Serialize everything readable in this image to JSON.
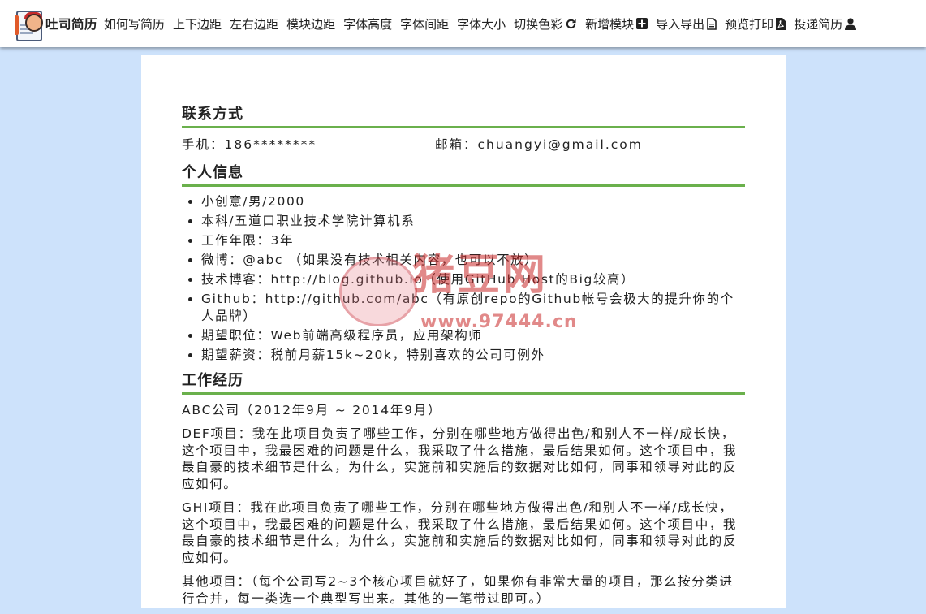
{
  "header": {
    "brand": "吐司简历",
    "nav": [
      {
        "label": "如何写简历",
        "icon": ""
      },
      {
        "label": "上下边距",
        "icon": ""
      },
      {
        "label": "左右边距",
        "icon": ""
      },
      {
        "label": "模块边距",
        "icon": ""
      },
      {
        "label": "字体高度",
        "icon": ""
      },
      {
        "label": "字体间距",
        "icon": ""
      },
      {
        "label": "字体大小",
        "icon": ""
      },
      {
        "label": "切换色彩",
        "icon": "refresh-icon"
      },
      {
        "label": "新增模块",
        "icon": "plus-square-icon"
      },
      {
        "label": "导入导出",
        "icon": "file-text-icon"
      },
      {
        "label": "预览打印",
        "icon": "file-pdf-icon"
      },
      {
        "label": "投递简历",
        "icon": "user-icon"
      }
    ]
  },
  "resume": {
    "contact": {
      "title": "联系方式",
      "phone": "手机：186********",
      "email": "邮箱：chuangyi@gmail.com"
    },
    "personal": {
      "title": "个人信息",
      "items": [
        "小创意/男/2000",
        "本科/五道口职业技术学院计算机系",
        "工作年限：3年",
        "微博：@abc （如果没有技术相关内容，也可以不放）",
        "技术博客：http://blog.github.io（使用GitHub Host的Big较高）",
        "Github：http://github.com/abc（有原创repo的Github帐号会极大的提升你的个人品牌）",
        "期望职位：Web前端高级程序员，应用架构师",
        "期望薪资：税前月薪15k~20k，特别喜欢的公司可例外"
      ]
    },
    "experience": {
      "title": "工作经历",
      "company": "ABC公司（2012年9月 ~ 2014年9月）",
      "projects": [
        "DEF项目：我在此项目负责了哪些工作，分别在哪些地方做得出色/和别人不一样/成长快，这个项目中，我最困难的问题是什么，我采取了什么措施，最后结果如何。这个项目中，我最自豪的技术细节是什么，为什么，实施前和实施后的数据对比如何，同事和领导对此的反应如何。",
        "GHI项目：我在此项目负责了哪些工作，分别在哪些地方做得出色/和别人不一样/成长快，这个项目中，我最困难的问题是什么，我采取了什么措施，最后结果如何。这个项目中，我最自豪的技术细节是什么，为什么，实施前和实施后的数据对比如何，同事和领导对此的反应如何。",
        "其他项目：（每个公司写2~3个核心项目就好了，如果你有非常大量的项目，那么按分类进行合并，每一类选一个典型写出来。其他的一笔带过即可。）"
      ]
    }
  },
  "watermark": {
    "text": "猪豆网",
    "url": "www.97444.cn"
  }
}
